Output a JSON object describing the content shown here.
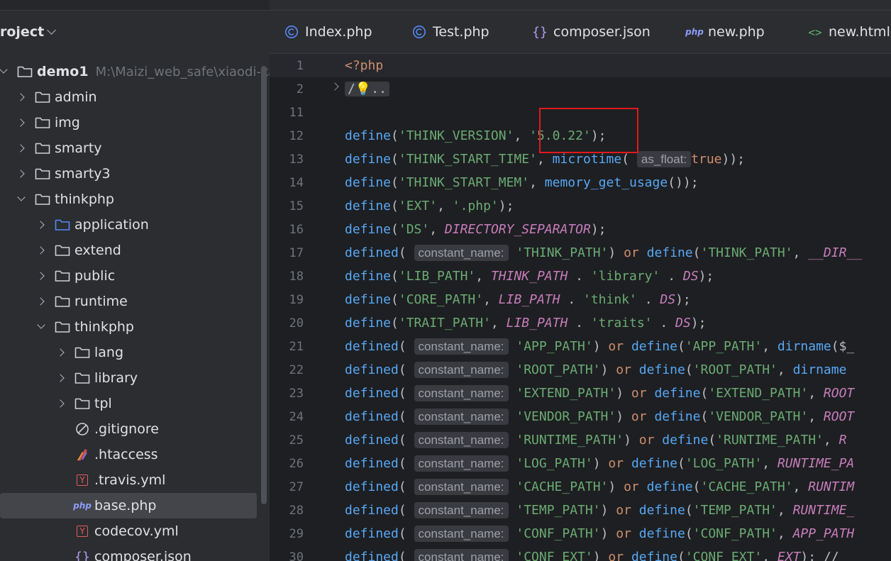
{
  "panel": {
    "title": "roject",
    "tree": [
      {
        "label": "demo1",
        "path": "M:\\Maizi_web_safe\\xiaodi-kaif",
        "depth": 0,
        "arrow": "expanded",
        "icon": "folder-icon",
        "bold": true
      },
      {
        "label": "admin",
        "depth": 1,
        "arrow": "collapsed",
        "icon": "folder-icon"
      },
      {
        "label": "img",
        "depth": 1,
        "arrow": "collapsed",
        "icon": "folder-icon"
      },
      {
        "label": "smarty",
        "depth": 1,
        "arrow": "collapsed",
        "icon": "folder-icon"
      },
      {
        "label": "smarty3",
        "depth": 1,
        "arrow": "collapsed",
        "icon": "folder-icon"
      },
      {
        "label": "thinkphp",
        "depth": 1,
        "arrow": "expanded",
        "icon": "folder-icon"
      },
      {
        "label": "application",
        "depth": 2,
        "arrow": "collapsed",
        "icon": "folder-blue-icon"
      },
      {
        "label": "extend",
        "depth": 2,
        "arrow": "collapsed",
        "icon": "folder-icon"
      },
      {
        "label": "public",
        "depth": 2,
        "arrow": "collapsed",
        "icon": "folder-icon"
      },
      {
        "label": "runtime",
        "depth": 2,
        "arrow": "collapsed",
        "icon": "folder-icon"
      },
      {
        "label": "thinkphp",
        "depth": 2,
        "arrow": "expanded",
        "icon": "folder-icon"
      },
      {
        "label": "lang",
        "depth": 3,
        "arrow": "collapsed",
        "icon": "folder-icon"
      },
      {
        "label": "library",
        "depth": 3,
        "arrow": "collapsed",
        "icon": "folder-icon"
      },
      {
        "label": "tpl",
        "depth": 3,
        "arrow": "collapsed",
        "icon": "folder-icon"
      },
      {
        "label": ".gitignore",
        "depth": 3,
        "arrow": "none",
        "icon": "gitignore-icon"
      },
      {
        "label": ".htaccess",
        "depth": 3,
        "arrow": "none",
        "icon": "htaccess-icon"
      },
      {
        "label": ".travis.yml",
        "depth": 3,
        "arrow": "none",
        "icon": "yaml-icon"
      },
      {
        "label": "base.php",
        "depth": 3,
        "arrow": "none",
        "icon": "php-icon",
        "selected": true
      },
      {
        "label": "codecov.yml",
        "depth": 3,
        "arrow": "none",
        "icon": "yaml-icon"
      },
      {
        "label": "composer.json",
        "depth": 3,
        "arrow": "none",
        "icon": "json-icon"
      }
    ]
  },
  "tabs": [
    {
      "label": "Index.php",
      "icon": "class-icon"
    },
    {
      "label": "Test.php",
      "icon": "class-icon"
    },
    {
      "label": "composer.json",
      "icon": "json-icon"
    },
    {
      "label": "new.php",
      "icon": "php-icon"
    },
    {
      "label": "new.html",
      "icon": "html-icon"
    }
  ],
  "icon_texts": {
    "php": "php",
    "yaml": "Y",
    "json": "{}",
    "html": "<>"
  },
  "code": {
    "lines": [
      {
        "n": "1",
        "segs": [
          [
            "orange",
            "<?php"
          ]
        ]
      },
      {
        "n": "2",
        "fold": true,
        "segs": [
          [
            "folded",
            "/💡.."
          ]
        ]
      },
      {
        "n": "11",
        "segs": []
      },
      {
        "n": "12",
        "segs": [
          [
            "kw",
            "define"
          ],
          [
            "punc",
            "("
          ],
          [
            "str",
            "'THINK_VERSION'"
          ],
          [
            "punc",
            ", "
          ],
          [
            "str",
            "'5.0.22'"
          ],
          [
            "punc",
            ");"
          ]
        ]
      },
      {
        "n": "13",
        "segs": [
          [
            "kw",
            "define"
          ],
          [
            "punc",
            "("
          ],
          [
            "str",
            "'THINK_START_TIME'"
          ],
          [
            "punc",
            ", "
          ],
          [
            "kw",
            "microtime"
          ],
          [
            "punc",
            "( "
          ],
          [
            "hint",
            "as_float:"
          ],
          [
            "orange",
            "true"
          ],
          [
            "punc",
            "));"
          ]
        ]
      },
      {
        "n": "14",
        "segs": [
          [
            "kw",
            "define"
          ],
          [
            "punc",
            "("
          ],
          [
            "str",
            "'THINK_START_MEM'"
          ],
          [
            "punc",
            ", "
          ],
          [
            "kw",
            "memory_get_usage"
          ],
          [
            "punc",
            "());"
          ]
        ]
      },
      {
        "n": "15",
        "segs": [
          [
            "kw",
            "define"
          ],
          [
            "punc",
            "("
          ],
          [
            "str",
            "'EXT'"
          ],
          [
            "punc",
            ", "
          ],
          [
            "str",
            "'.php'"
          ],
          [
            "punc",
            ");"
          ]
        ]
      },
      {
        "n": "16",
        "segs": [
          [
            "kw",
            "define"
          ],
          [
            "punc",
            "("
          ],
          [
            "str",
            "'DS'"
          ],
          [
            "punc",
            ", "
          ],
          [
            "const",
            "DIRECTORY_SEPARATOR"
          ],
          [
            "punc",
            ");"
          ]
        ]
      },
      {
        "n": "17",
        "segs": [
          [
            "kw",
            "defined"
          ],
          [
            "punc",
            "( "
          ],
          [
            "hint",
            "constant_name:"
          ],
          [
            "str",
            " 'THINK_PATH'"
          ],
          [
            "punc",
            ") "
          ],
          [
            "orange",
            "or"
          ],
          [
            "punc",
            " "
          ],
          [
            "kw",
            "define"
          ],
          [
            "punc",
            "("
          ],
          [
            "str",
            "'THINK_PATH'"
          ],
          [
            "punc",
            ", "
          ],
          [
            "const",
            "__DIR__"
          ]
        ]
      },
      {
        "n": "18",
        "segs": [
          [
            "kw",
            "define"
          ],
          [
            "punc",
            "("
          ],
          [
            "str",
            "'LIB_PATH'"
          ],
          [
            "punc",
            ", "
          ],
          [
            "const",
            "THINK_PATH"
          ],
          [
            "punc",
            " . "
          ],
          [
            "str",
            "'library'"
          ],
          [
            "punc",
            " . "
          ],
          [
            "const",
            "DS"
          ],
          [
            "punc",
            ");"
          ]
        ]
      },
      {
        "n": "19",
        "segs": [
          [
            "kw",
            "define"
          ],
          [
            "punc",
            "("
          ],
          [
            "str",
            "'CORE_PATH'"
          ],
          [
            "punc",
            ", "
          ],
          [
            "const",
            "LIB_PATH"
          ],
          [
            "punc",
            " . "
          ],
          [
            "str",
            "'think'"
          ],
          [
            "punc",
            " . "
          ],
          [
            "const",
            "DS"
          ],
          [
            "punc",
            ");"
          ]
        ]
      },
      {
        "n": "20",
        "segs": [
          [
            "kw",
            "define"
          ],
          [
            "punc",
            "("
          ],
          [
            "str",
            "'TRAIT_PATH'"
          ],
          [
            "punc",
            ", "
          ],
          [
            "const",
            "LIB_PATH"
          ],
          [
            "punc",
            " . "
          ],
          [
            "str",
            "'traits'"
          ],
          [
            "punc",
            " . "
          ],
          [
            "const",
            "DS"
          ],
          [
            "punc",
            ");"
          ]
        ]
      },
      {
        "n": "21",
        "segs": [
          [
            "kw",
            "defined"
          ],
          [
            "punc",
            "( "
          ],
          [
            "hint",
            "constant_name:"
          ],
          [
            "str",
            " 'APP_PATH'"
          ],
          [
            "punc",
            ") "
          ],
          [
            "orange",
            "or"
          ],
          [
            "punc",
            " "
          ],
          [
            "kw",
            "define"
          ],
          [
            "punc",
            "("
          ],
          [
            "str",
            "'APP_PATH'"
          ],
          [
            "punc",
            ", "
          ],
          [
            "kw",
            "dirname"
          ],
          [
            "punc",
            "($_"
          ]
        ]
      },
      {
        "n": "22",
        "segs": [
          [
            "kw",
            "defined"
          ],
          [
            "punc",
            "( "
          ],
          [
            "hint",
            "constant_name:"
          ],
          [
            "str",
            " 'ROOT_PATH'"
          ],
          [
            "punc",
            ") "
          ],
          [
            "orange",
            "or"
          ],
          [
            "punc",
            " "
          ],
          [
            "kw",
            "define"
          ],
          [
            "punc",
            "("
          ],
          [
            "str",
            "'ROOT_PATH'"
          ],
          [
            "punc",
            ", "
          ],
          [
            "kw",
            "dirname"
          ]
        ]
      },
      {
        "n": "23",
        "segs": [
          [
            "kw",
            "defined"
          ],
          [
            "punc",
            "( "
          ],
          [
            "hint",
            "constant_name:"
          ],
          [
            "str",
            " 'EXTEND_PATH'"
          ],
          [
            "punc",
            ") "
          ],
          [
            "orange",
            "or"
          ],
          [
            "punc",
            " "
          ],
          [
            "kw",
            "define"
          ],
          [
            "punc",
            "("
          ],
          [
            "str",
            "'EXTEND_PATH'"
          ],
          [
            "punc",
            ", "
          ],
          [
            "const",
            "ROOT"
          ]
        ]
      },
      {
        "n": "24",
        "segs": [
          [
            "kw",
            "defined"
          ],
          [
            "punc",
            "( "
          ],
          [
            "hint",
            "constant_name:"
          ],
          [
            "str",
            " 'VENDOR_PATH'"
          ],
          [
            "punc",
            ") "
          ],
          [
            "orange",
            "or"
          ],
          [
            "punc",
            " "
          ],
          [
            "kw",
            "define"
          ],
          [
            "punc",
            "("
          ],
          [
            "str",
            "'VENDOR_PATH'"
          ],
          [
            "punc",
            ", "
          ],
          [
            "const",
            "ROOT"
          ]
        ]
      },
      {
        "n": "25",
        "segs": [
          [
            "kw",
            "defined"
          ],
          [
            "punc",
            "( "
          ],
          [
            "hint",
            "constant_name:"
          ],
          [
            "str",
            " 'RUNTIME_PATH'"
          ],
          [
            "punc",
            ") "
          ],
          [
            "orange",
            "or"
          ],
          [
            "punc",
            " "
          ],
          [
            "kw",
            "define"
          ],
          [
            "punc",
            "("
          ],
          [
            "str",
            "'RUNTIME_PATH'"
          ],
          [
            "punc",
            ", "
          ],
          [
            "const",
            "R"
          ]
        ]
      },
      {
        "n": "26",
        "segs": [
          [
            "kw",
            "defined"
          ],
          [
            "punc",
            "( "
          ],
          [
            "hint",
            "constant_name:"
          ],
          [
            "str",
            " 'LOG_PATH'"
          ],
          [
            "punc",
            ") "
          ],
          [
            "orange",
            "or"
          ],
          [
            "punc",
            " "
          ],
          [
            "kw",
            "define"
          ],
          [
            "punc",
            "("
          ],
          [
            "str",
            "'LOG_PATH'"
          ],
          [
            "punc",
            ", "
          ],
          [
            "const",
            "RUNTIME_PA"
          ]
        ]
      },
      {
        "n": "27",
        "segs": [
          [
            "kw",
            "defined"
          ],
          [
            "punc",
            "( "
          ],
          [
            "hint",
            "constant_name:"
          ],
          [
            "str",
            " 'CACHE_PATH'"
          ],
          [
            "punc",
            ") "
          ],
          [
            "orange",
            "or"
          ],
          [
            "punc",
            " "
          ],
          [
            "kw",
            "define"
          ],
          [
            "punc",
            "("
          ],
          [
            "str",
            "'CACHE_PATH'"
          ],
          [
            "punc",
            ", "
          ],
          [
            "const",
            "RUNTIM"
          ]
        ]
      },
      {
        "n": "28",
        "segs": [
          [
            "kw",
            "defined"
          ],
          [
            "punc",
            "( "
          ],
          [
            "hint",
            "constant_name:"
          ],
          [
            "str",
            " 'TEMP_PATH'"
          ],
          [
            "punc",
            ") "
          ],
          [
            "orange",
            "or"
          ],
          [
            "punc",
            " "
          ],
          [
            "kw",
            "define"
          ],
          [
            "punc",
            "("
          ],
          [
            "str",
            "'TEMP_PATH'"
          ],
          [
            "punc",
            ", "
          ],
          [
            "const",
            "RUNTIME_"
          ]
        ]
      },
      {
        "n": "29",
        "segs": [
          [
            "kw",
            "defined"
          ],
          [
            "punc",
            "( "
          ],
          [
            "hint",
            "constant_name:"
          ],
          [
            "str",
            " 'CONF_PATH'"
          ],
          [
            "punc",
            ") "
          ],
          [
            "orange",
            "or"
          ],
          [
            "punc",
            " "
          ],
          [
            "kw",
            "define"
          ],
          [
            "punc",
            "("
          ],
          [
            "str",
            "'CONF_PATH'"
          ],
          [
            "punc",
            ", "
          ],
          [
            "const",
            "APP_PATH"
          ]
        ]
      },
      {
        "n": "30",
        "segs": [
          [
            "kw",
            "defined"
          ],
          [
            "punc",
            "( "
          ],
          [
            "hint",
            "constant_name:"
          ],
          [
            "str",
            " 'CONF_EXT'"
          ],
          [
            "punc",
            ") "
          ],
          [
            "orange",
            "or"
          ],
          [
            "punc",
            " "
          ],
          [
            "kw",
            "define"
          ],
          [
            "punc",
            "("
          ],
          [
            "str",
            "'CONF_EXT'"
          ],
          [
            "punc",
            ", "
          ],
          [
            "const",
            "EXT"
          ],
          [
            "punc",
            "); // "
          ]
        ]
      }
    ]
  },
  "colors": {
    "highlight_box": "#e0191b",
    "keyword": "#56a8f5",
    "string": "#6aab73"
  }
}
